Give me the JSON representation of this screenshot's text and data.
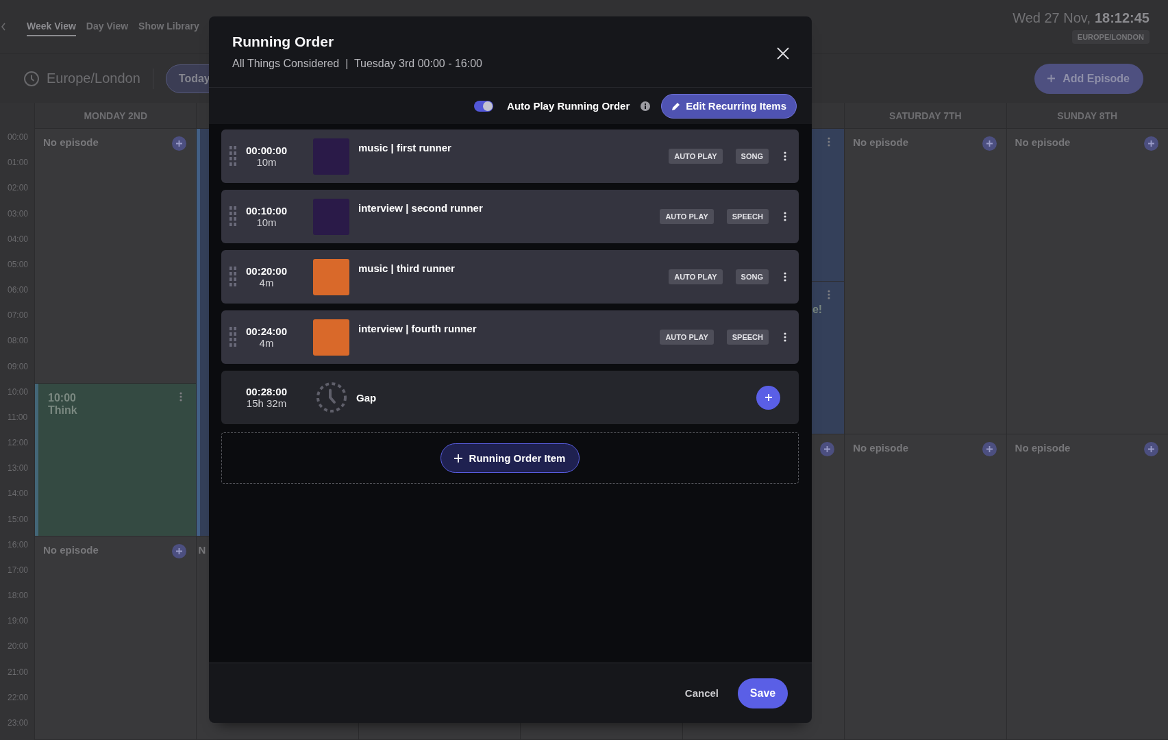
{
  "header": {
    "tabs": [
      {
        "label": "Week View",
        "selected": true
      },
      {
        "label": "Day View",
        "selected": false
      },
      {
        "label": "Show Library",
        "selected": false
      }
    ],
    "date": "Wed 27 Nov,",
    "time": "18:12:45",
    "timezone_badge": "EUROPE/LONDON"
  },
  "toolbar": {
    "timezone": "Europe/London",
    "today_button": "Today",
    "add_episode_button": "Add Episode"
  },
  "calendar": {
    "hours": [
      "00:00",
      "01:00",
      "02:00",
      "03:00",
      "04:00",
      "05:00",
      "06:00",
      "07:00",
      "08:00",
      "09:00",
      "10:00",
      "11:00",
      "12:00",
      "13:00",
      "14:00",
      "15:00",
      "16:00",
      "17:00",
      "18:00",
      "19:00",
      "20:00",
      "21:00",
      "22:00",
      "23:00"
    ],
    "days": [
      {
        "label": "MONDAY 2ND",
        "slots": [
          {
            "kind": "empty",
            "label": "No episode",
            "add": true
          },
          {
            "kind": "more"
          },
          {
            "kind": "more"
          },
          {
            "kind": "more"
          },
          {
            "kind": "more"
          },
          {
            "kind": "more"
          },
          {
            "kind": "more"
          },
          {
            "kind": "more"
          },
          {
            "kind": "more"
          },
          {
            "kind": "more"
          },
          {
            "kind": "event",
            "time": "10:00",
            "title": "Think",
            "color": "#344a42",
            "menu": true
          },
          {
            "kind": "more"
          },
          {
            "kind": "more"
          },
          {
            "kind": "more"
          },
          {
            "kind": "more"
          },
          {
            "kind": "more"
          },
          {
            "kind": "empty",
            "label": "No episode",
            "add": true
          },
          {
            "kind": "more"
          },
          {
            "kind": "more"
          },
          {
            "kind": "more"
          },
          {
            "kind": "more"
          },
          {
            "kind": "more"
          },
          {
            "kind": "more"
          },
          {
            "kind": "more"
          }
        ]
      },
      {
        "slots": [
          {
            "kind": "event",
            "color": "#34405a",
            "menu": false
          },
          {
            "kind": "more"
          },
          {
            "kind": "more"
          },
          {
            "kind": "more"
          },
          {
            "kind": "more"
          },
          {
            "kind": "more"
          },
          {
            "kind": "more"
          },
          {
            "kind": "more"
          },
          {
            "kind": "more"
          },
          {
            "kind": "more"
          },
          {
            "kind": "more"
          },
          {
            "kind": "more"
          },
          {
            "kind": "more"
          },
          {
            "kind": "more"
          },
          {
            "kind": "more"
          },
          {
            "kind": "more"
          },
          {
            "kind": "empty",
            "label": "N",
            "clipped": true,
            "add": false
          },
          {
            "kind": "more"
          },
          {
            "kind": "more"
          },
          {
            "kind": "more"
          },
          {
            "kind": "more"
          },
          {
            "kind": "more"
          },
          {
            "kind": "more"
          },
          {
            "kind": "more"
          }
        ]
      },
      {
        "slots": [
          {
            "kind": "empty",
            "add": false
          },
          {
            "kind": "more"
          },
          {
            "kind": "more"
          },
          {
            "kind": "more"
          },
          {
            "kind": "more"
          },
          {
            "kind": "more"
          },
          {
            "kind": "more"
          },
          {
            "kind": "more"
          },
          {
            "kind": "more"
          },
          {
            "kind": "more"
          },
          {
            "kind": "more"
          },
          {
            "kind": "more"
          },
          {
            "kind": "more"
          },
          {
            "kind": "more"
          },
          {
            "kind": "more"
          },
          {
            "kind": "more"
          },
          {
            "kind": "more"
          },
          {
            "kind": "more"
          },
          {
            "kind": "more"
          },
          {
            "kind": "more"
          },
          {
            "kind": "more"
          },
          {
            "kind": "more"
          },
          {
            "kind": "more"
          },
          {
            "kind": "more"
          }
        ]
      },
      {
        "slots": [
          {
            "kind": "empty",
            "add": false
          },
          {
            "kind": "more"
          },
          {
            "kind": "more"
          },
          {
            "kind": "more"
          },
          {
            "kind": "more"
          },
          {
            "kind": "more"
          },
          {
            "kind": "more"
          },
          {
            "kind": "more"
          },
          {
            "kind": "more"
          },
          {
            "kind": "more"
          },
          {
            "kind": "more"
          },
          {
            "kind": "more"
          },
          {
            "kind": "more"
          },
          {
            "kind": "more"
          },
          {
            "kind": "more"
          },
          {
            "kind": "more"
          },
          {
            "kind": "more"
          },
          {
            "kind": "more"
          },
          {
            "kind": "more"
          },
          {
            "kind": "more"
          },
          {
            "kind": "more"
          },
          {
            "kind": "more"
          },
          {
            "kind": "more"
          },
          {
            "kind": "more"
          }
        ]
      },
      {
        "slots": [
          {
            "kind": "event",
            "color": "#34405a",
            "menu": true
          },
          {
            "kind": "more"
          },
          {
            "kind": "more"
          },
          {
            "kind": "more"
          },
          {
            "kind": "more"
          },
          {
            "kind": "more"
          },
          {
            "kind": "event",
            "title": "e!",
            "clipped": true,
            "color": "#34405a",
            "menu": true
          },
          {
            "kind": "more"
          },
          {
            "kind": "more"
          },
          {
            "kind": "more"
          },
          {
            "kind": "more"
          },
          {
            "kind": "more"
          },
          {
            "kind": "empty",
            "add": true
          },
          {
            "kind": "more"
          },
          {
            "kind": "more"
          },
          {
            "kind": "more"
          },
          {
            "kind": "more"
          },
          {
            "kind": "more"
          },
          {
            "kind": "more"
          },
          {
            "kind": "more"
          },
          {
            "kind": "more"
          },
          {
            "kind": "more"
          },
          {
            "kind": "more"
          },
          {
            "kind": "more"
          }
        ]
      },
      {
        "label": "SATURDAY 7TH",
        "slots": [
          {
            "kind": "empty",
            "label": "No episode",
            "add": true
          },
          {
            "kind": "more"
          },
          {
            "kind": "more"
          },
          {
            "kind": "more"
          },
          {
            "kind": "more"
          },
          {
            "kind": "more"
          },
          {
            "kind": "more"
          },
          {
            "kind": "more"
          },
          {
            "kind": "more"
          },
          {
            "kind": "more"
          },
          {
            "kind": "more"
          },
          {
            "kind": "more"
          },
          {
            "kind": "empty",
            "label": "No episode",
            "add": true
          },
          {
            "kind": "more"
          },
          {
            "kind": "more"
          },
          {
            "kind": "more"
          },
          {
            "kind": "more"
          },
          {
            "kind": "more"
          },
          {
            "kind": "more"
          },
          {
            "kind": "more"
          },
          {
            "kind": "more"
          },
          {
            "kind": "more"
          },
          {
            "kind": "more"
          },
          {
            "kind": "more"
          }
        ]
      },
      {
        "label": "SUNDAY 8TH",
        "slots": [
          {
            "kind": "empty",
            "label": "No episode",
            "add": true
          },
          {
            "kind": "more"
          },
          {
            "kind": "more"
          },
          {
            "kind": "more"
          },
          {
            "kind": "more"
          },
          {
            "kind": "more"
          },
          {
            "kind": "more"
          },
          {
            "kind": "more"
          },
          {
            "kind": "more"
          },
          {
            "kind": "more"
          },
          {
            "kind": "more"
          },
          {
            "kind": "more"
          },
          {
            "kind": "empty",
            "label": "No episode",
            "add": true
          },
          {
            "kind": "more"
          },
          {
            "kind": "more"
          },
          {
            "kind": "more"
          },
          {
            "kind": "more"
          },
          {
            "kind": "more"
          },
          {
            "kind": "more"
          },
          {
            "kind": "more"
          },
          {
            "kind": "more"
          },
          {
            "kind": "more"
          },
          {
            "kind": "more"
          },
          {
            "kind": "more"
          }
        ]
      }
    ]
  },
  "running_order": {
    "title": "Running Order",
    "subtitle": "All Things Considered  |  Tuesday 3rd 00:00 - 16:00",
    "auto_play": {
      "label": "Auto Play Running Order",
      "on": true
    },
    "edit_button": "Edit Recurring Items",
    "items": [
      {
        "kind": "item",
        "time": "00:00:00",
        "duration": "10m",
        "title": "music | first runner",
        "color": "#2a1a48",
        "badges": [
          "AUTO PLAY",
          "SONG"
        ]
      },
      {
        "kind": "item",
        "time": "00:10:00",
        "duration": "10m",
        "title": "interview | second runner",
        "color": "#2a1a48",
        "badges": [
          "AUTO PLAY",
          "SPEECH"
        ]
      },
      {
        "kind": "item",
        "time": "00:20:00",
        "duration": "4m",
        "title": "music | third runner",
        "color": "#d9692a",
        "badges": [
          "AUTO PLAY",
          "SONG"
        ]
      },
      {
        "kind": "item",
        "time": "00:24:00",
        "duration": "4m",
        "title": "interview | fourth runner",
        "color": "#d9692a",
        "badges": [
          "AUTO PLAY",
          "SPEECH"
        ]
      },
      {
        "kind": "gap",
        "time": "00:28:00",
        "duration": "15h 32m",
        "title": "Gap"
      }
    ],
    "add_item_button": "Running Order Item",
    "cancel_button": "Cancel",
    "save_button": "Save"
  }
}
